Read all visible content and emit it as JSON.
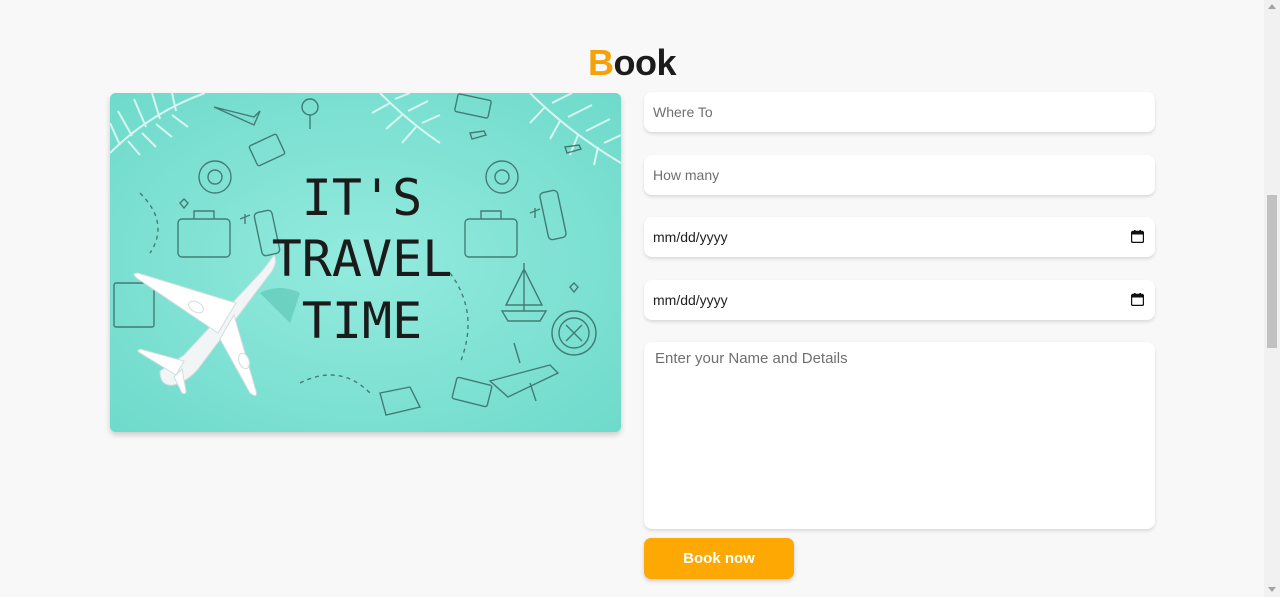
{
  "heading": {
    "accent_letter": "B",
    "rest": "ook"
  },
  "image": {
    "line1": "IT'S",
    "line2": "TRAVEL",
    "line3": "TIME"
  },
  "form": {
    "where_to_placeholder": "Where To",
    "how_many_placeholder": "How many",
    "arrival_date_value": "mm/dd/yyyy",
    "leaving_date_value": "mm/dd/yyyy",
    "details_placeholder": "Enter your Name and Details",
    "submit_label": "Book now"
  },
  "colors": {
    "accent": "#fea903",
    "image_bg": "#7fe0d2"
  }
}
